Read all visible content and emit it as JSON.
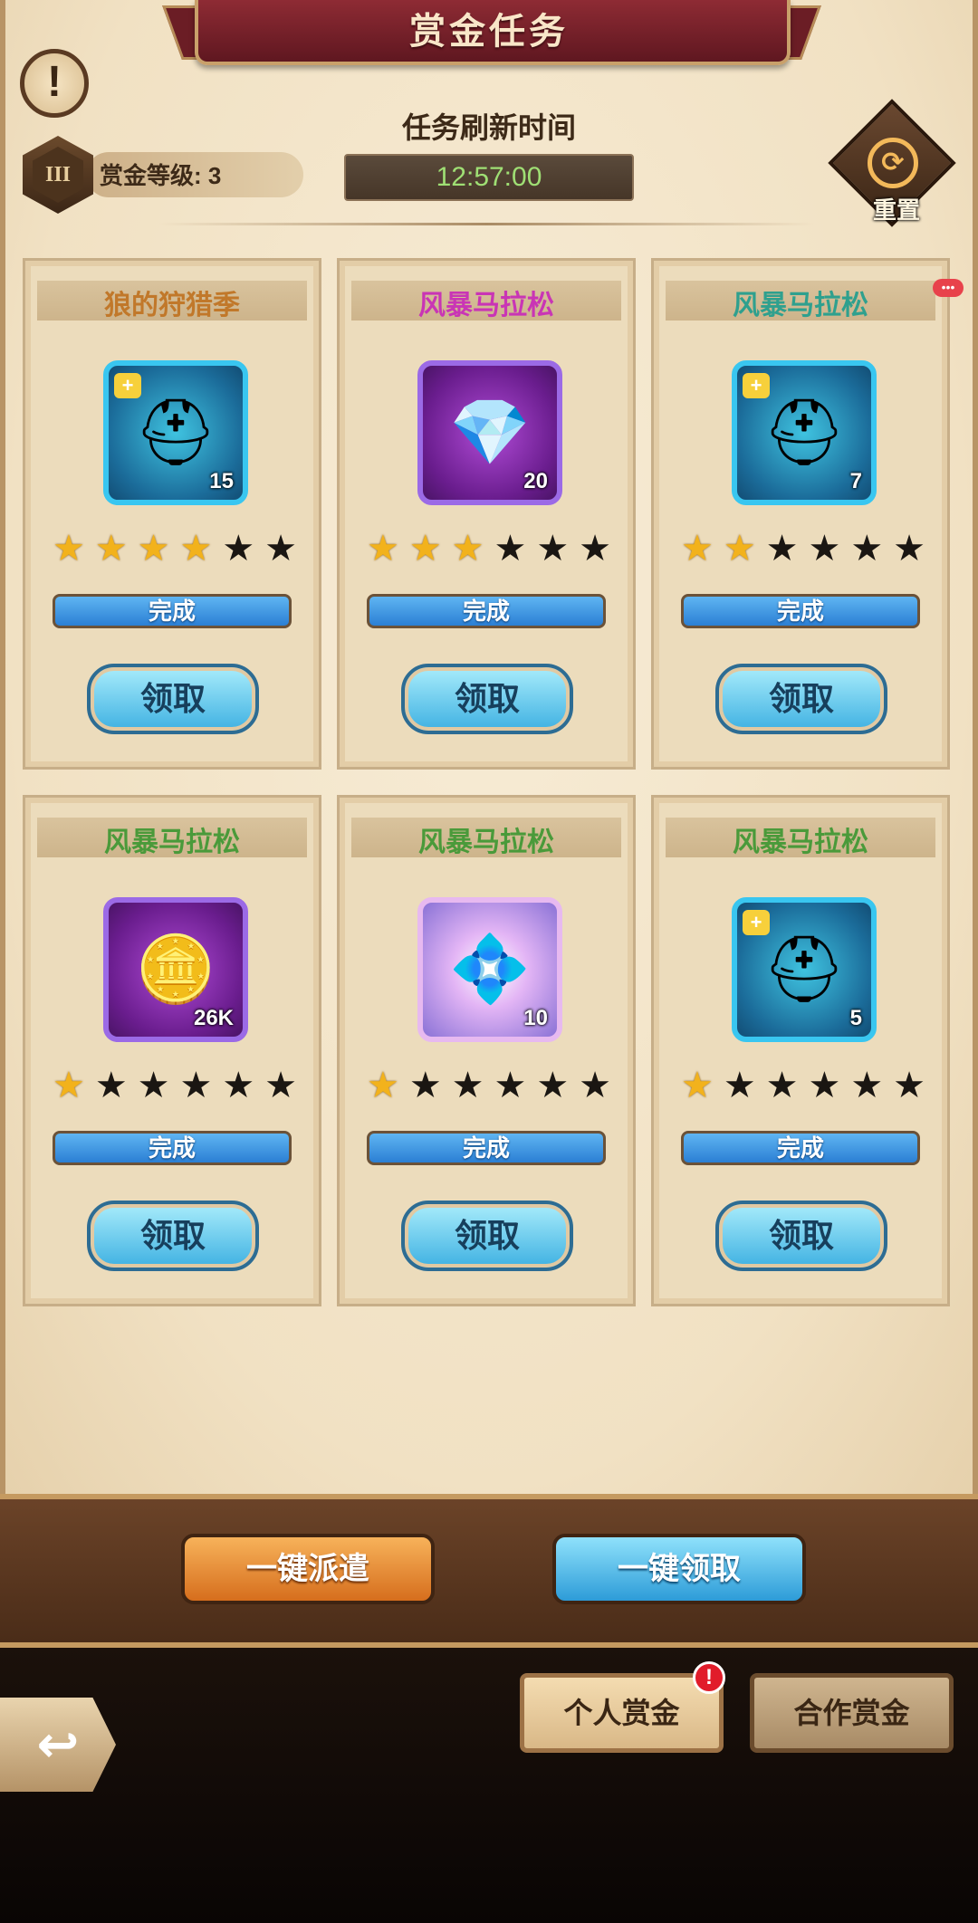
{
  "header": {
    "title": "赏金任务",
    "info_icon": "!",
    "level_badge": "III",
    "level_text": "赏金等级: 3",
    "refresh_label": "任务刷新时间",
    "refresh_timer": "12:57:00",
    "reset_label": "重置",
    "reset_icon": "⟳"
  },
  "cards": [
    {
      "title": "狼的狩猎季",
      "title_color": "#c1782a",
      "frame": "blue",
      "icon": "⛑",
      "icon_name": "helmet-puzzle-icon",
      "puzzle": true,
      "count": "15",
      "stars_total": 6,
      "stars_filled": 4,
      "status": "完成",
      "claim_label": "领取",
      "alert_dots": ""
    },
    {
      "title": "风暴马拉松",
      "title_color": "#c935b5",
      "frame": "purple",
      "icon": "💎",
      "icon_name": "blue-gem-icon",
      "puzzle": false,
      "count": "20",
      "stars_total": 6,
      "stars_filled": 3,
      "status": "完成",
      "claim_label": "领取",
      "alert_dots": ""
    },
    {
      "title": "风暴马拉松",
      "title_color": "#2fa08e",
      "frame": "blue",
      "icon": "⛑",
      "icon_name": "helmet-puzzle-icon",
      "puzzle": true,
      "count": "7",
      "stars_total": 6,
      "stars_filled": 2,
      "status": "完成",
      "claim_label": "领取",
      "alert_dots": "•••"
    },
    {
      "title": "风暴马拉松",
      "title_color": "#4a9a3a",
      "frame": "purple",
      "icon": "🪙",
      "icon_name": "gold-coin-icon",
      "puzzle": false,
      "count": "26K",
      "stars_total": 6,
      "stars_filled": 1,
      "status": "完成",
      "claim_label": "领取",
      "alert_dots": ""
    },
    {
      "title": "风暴马拉松",
      "title_color": "#4a9a3a",
      "frame": "pink",
      "icon": "💠",
      "icon_name": "diamond-icon",
      "puzzle": false,
      "count": "10",
      "stars_total": 6,
      "stars_filled": 1,
      "status": "完成",
      "claim_label": "领取",
      "alert_dots": ""
    },
    {
      "title": "风暴马拉松",
      "title_color": "#4a9a3a",
      "frame": "blue",
      "icon": "⛑",
      "icon_name": "helmet-puzzle-icon",
      "puzzle": true,
      "count": "5",
      "stars_total": 6,
      "stars_filled": 1,
      "status": "完成",
      "claim_label": "领取",
      "alert_dots": ""
    }
  ],
  "actions": {
    "dispatch_all": "一键派遣",
    "claim_all": "一键领取"
  },
  "tabs": {
    "personal": "个人赏金",
    "personal_badge": "!",
    "coop": "合作赏金"
  },
  "nav": {
    "back_icon": "↩"
  }
}
